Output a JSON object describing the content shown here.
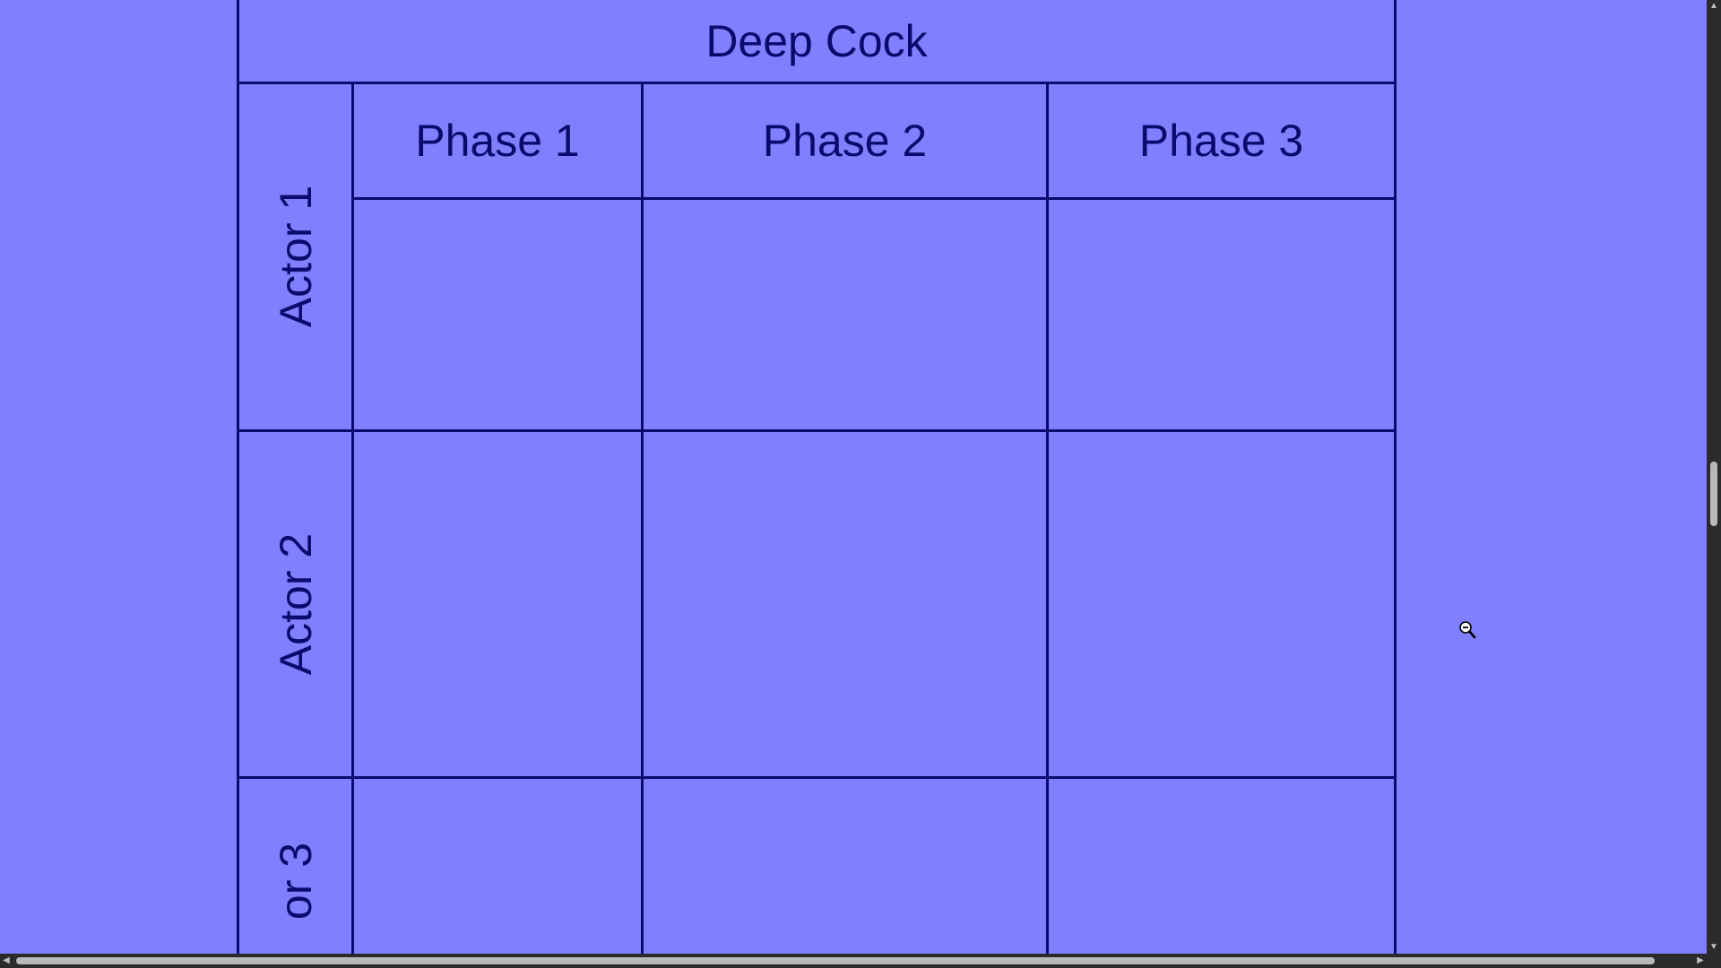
{
  "diagram": {
    "title": "Deep Cock",
    "phases": [
      "Phase 1",
      "Phase 2",
      "Phase 3"
    ],
    "actors": [
      "Actor 1",
      "Actor 2",
      "or 3"
    ]
  },
  "colors": {
    "background": "#8080ff",
    "line": "#0a0a70",
    "text": "#0b0b6e",
    "scrollbar_track": "#2b2b2b",
    "scrollbar_thumb": "#b9b9b9"
  },
  "cursor": {
    "icon": "zoom-out-cursor-icon"
  },
  "scrollbars": {
    "up_arrow": "▲",
    "down_arrow": "▼",
    "left_arrow": "◀",
    "right_arrow": "▶"
  }
}
